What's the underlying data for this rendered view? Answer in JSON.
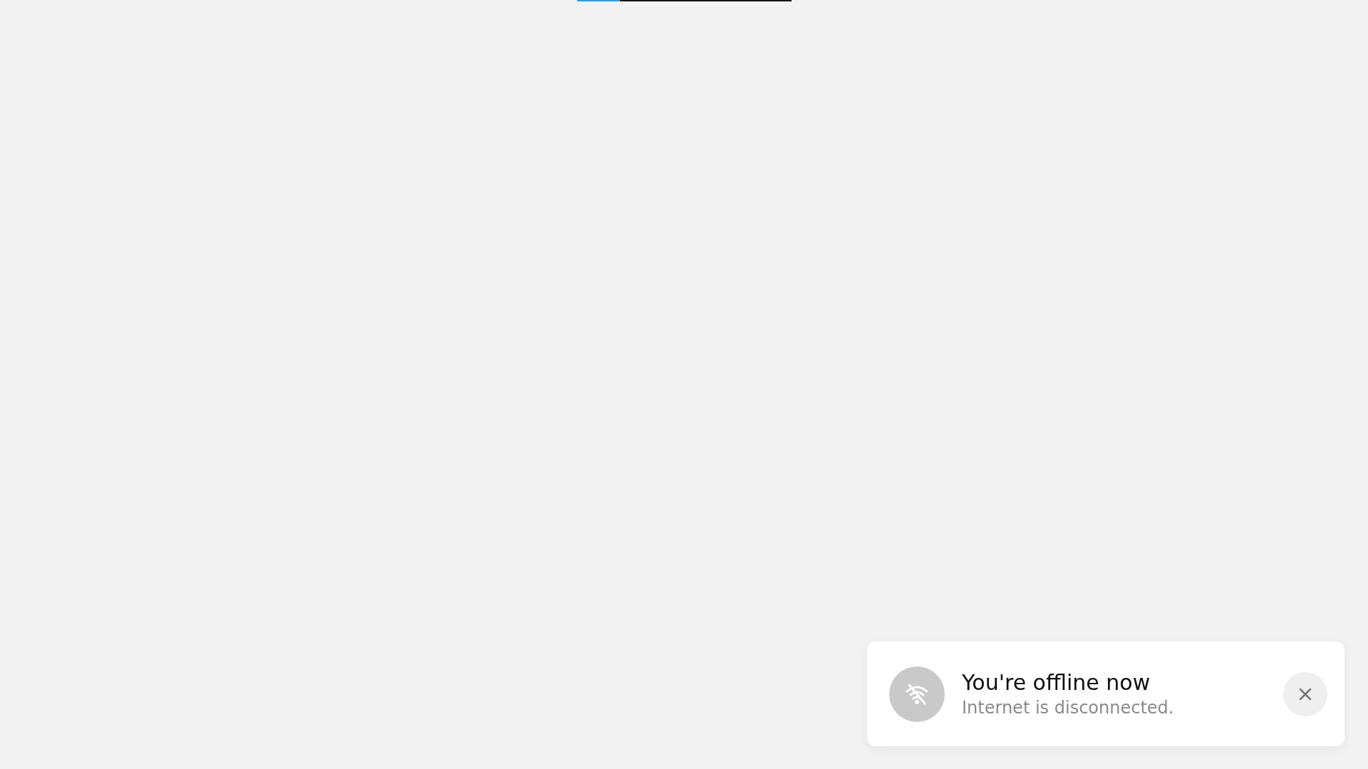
{
  "progress": {
    "level": 0.2
  },
  "toast": {
    "title": "You're offline now",
    "message": "Internet is disconnected.",
    "offline": true
  }
}
